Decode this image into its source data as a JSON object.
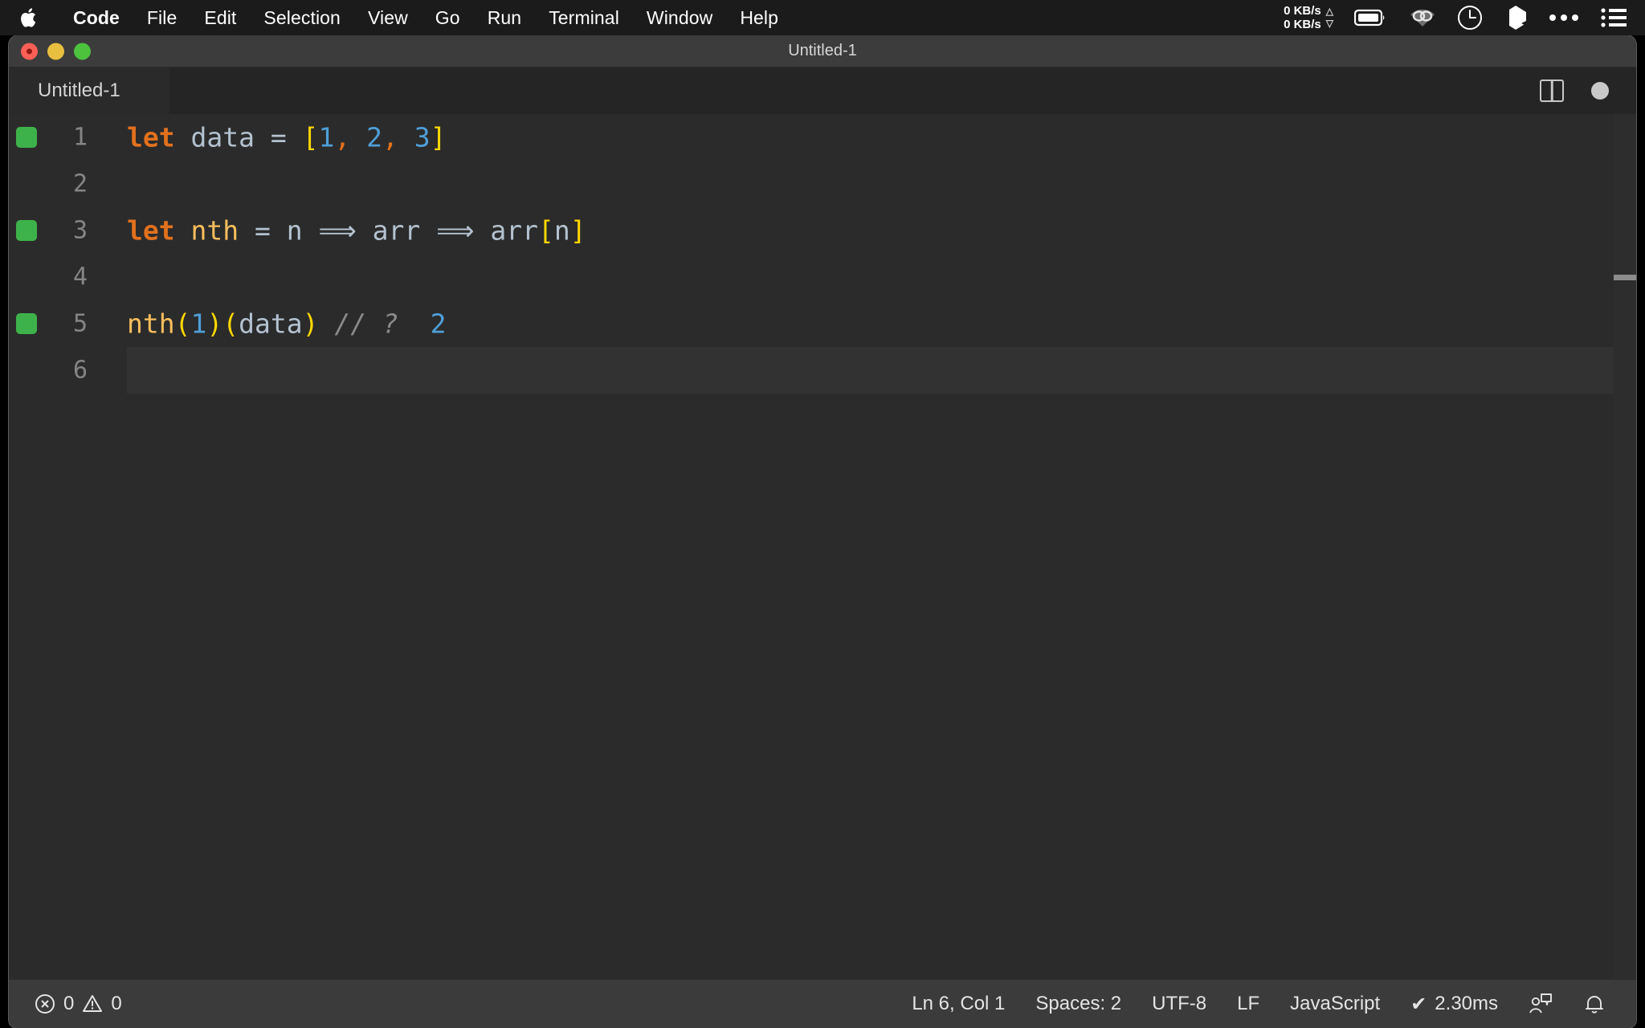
{
  "menubar": {
    "apple_icon": "apple-logo-icon",
    "items": [
      {
        "label": "Code",
        "bold": true
      },
      {
        "label": "File",
        "bold": false
      },
      {
        "label": "Edit",
        "bold": false
      },
      {
        "label": "Selection",
        "bold": false
      },
      {
        "label": "View",
        "bold": false
      },
      {
        "label": "Go",
        "bold": false
      },
      {
        "label": "Run",
        "bold": false
      },
      {
        "label": "Terminal",
        "bold": false
      },
      {
        "label": "Window",
        "bold": false
      },
      {
        "label": "Help",
        "bold": false
      }
    ],
    "tray": {
      "network_up": "0 KB/s",
      "network_down": "0 KB/s",
      "up_arrow": "△",
      "down_arrow": "▽",
      "icons": [
        "battery-icon",
        "wifi-icon",
        "clock-icon",
        "dropbox-icon",
        "ellipsis-icon",
        "control-center-icon"
      ]
    }
  },
  "window": {
    "title": "Untitled-1",
    "traffic_lights": [
      "close-button",
      "minimize-button",
      "maximize-button"
    ]
  },
  "tabbar": {
    "tabs": [
      {
        "label": "Untitled-1",
        "active": true,
        "dirty": true
      }
    ],
    "actions": [
      "split-editor-button",
      "unsaved-indicator"
    ]
  },
  "editor": {
    "language": "JavaScript",
    "lines": [
      {
        "number": "1",
        "quokka": true,
        "current": false,
        "tokens": [
          {
            "t": "let",
            "c": "kw"
          },
          {
            "t": " ",
            "c": "plain"
          },
          {
            "t": "data",
            "c": "var"
          },
          {
            "t": " ",
            "c": "plain"
          },
          {
            "t": "=",
            "c": "op"
          },
          {
            "t": " ",
            "c": "plain"
          },
          {
            "t": "[",
            "c": "bracket"
          },
          {
            "t": "1",
            "c": "num"
          },
          {
            "t": ",",
            "c": "comma"
          },
          {
            "t": " ",
            "c": "plain"
          },
          {
            "t": "2",
            "c": "num"
          },
          {
            "t": ",",
            "c": "comma"
          },
          {
            "t": " ",
            "c": "plain"
          },
          {
            "t": "3",
            "c": "num"
          },
          {
            "t": "]",
            "c": "bracket"
          }
        ]
      },
      {
        "number": "2",
        "quokka": false,
        "current": false,
        "tokens": []
      },
      {
        "number": "3",
        "quokka": true,
        "current": false,
        "tokens": [
          {
            "t": "let",
            "c": "kw"
          },
          {
            "t": " ",
            "c": "plain"
          },
          {
            "t": "nth",
            "c": "fn"
          },
          {
            "t": " ",
            "c": "plain"
          },
          {
            "t": "=",
            "c": "op"
          },
          {
            "t": " ",
            "c": "plain"
          },
          {
            "t": "n",
            "c": "var"
          },
          {
            "t": " ",
            "c": "plain"
          },
          {
            "t": "⟹",
            "c": "arrow"
          },
          {
            "t": " ",
            "c": "plain"
          },
          {
            "t": "arr",
            "c": "var"
          },
          {
            "t": " ",
            "c": "plain"
          },
          {
            "t": "⟹",
            "c": "arrow"
          },
          {
            "t": " ",
            "c": "plain"
          },
          {
            "t": "arr",
            "c": "var"
          },
          {
            "t": "[",
            "c": "bracket"
          },
          {
            "t": "n",
            "c": "var"
          },
          {
            "t": "]",
            "c": "bracket"
          }
        ]
      },
      {
        "number": "4",
        "quokka": false,
        "current": false,
        "tokens": []
      },
      {
        "number": "5",
        "quokka": true,
        "current": false,
        "tokens": [
          {
            "t": "nth",
            "c": "fn"
          },
          {
            "t": "(",
            "c": "bracket"
          },
          {
            "t": "1",
            "c": "num"
          },
          {
            "t": ")",
            "c": "bracket"
          },
          {
            "t": "(",
            "c": "bracket"
          },
          {
            "t": "data",
            "c": "var"
          },
          {
            "t": ")",
            "c": "bracket"
          },
          {
            "t": " ",
            "c": "plain"
          },
          {
            "t": "//",
            "c": "comment"
          },
          {
            "t": " ",
            "c": "plain"
          },
          {
            "t": "?",
            "c": "comment"
          },
          {
            "t": "  ",
            "c": "plain"
          },
          {
            "t": "2",
            "c": "num"
          }
        ]
      },
      {
        "number": "6",
        "quokka": false,
        "current": true,
        "tokens": []
      }
    ],
    "source_text": "let data = [1, 2, 3]\n\nlet nth = n => arr => arr[n]\n\nnth(1)(data) // ? 2\n"
  },
  "statusbar": {
    "errors": "0",
    "warnings": "0",
    "error_icon": "error-circle-icon",
    "warning_icon": "warning-triangle-icon",
    "cursor_position": "Ln 6, Col 1",
    "indentation": "Spaces: 2",
    "encoding": "UTF-8",
    "eol": "LF",
    "language_mode": "JavaScript",
    "runtime_check": "✔",
    "runtime_time": "2.30ms",
    "feedback_icon": "feedback-person-icon",
    "notifications_icon": "bell-icon"
  },
  "colors": {
    "menubar_bg": "#1b1b1b",
    "titlebar_bg": "#3c3c3c",
    "tabbar_bg": "#252526",
    "editor_bg": "#2b2b2b",
    "statusbar_bg": "#3b3b3b",
    "keyword": "#e2711d",
    "number": "#4f9fd8",
    "bracket": "#ffd700",
    "function": "#fbbf5c",
    "variable": "#b4c2d0",
    "comment": "#8a8a8a",
    "quokka_green": "#3eb24a"
  }
}
